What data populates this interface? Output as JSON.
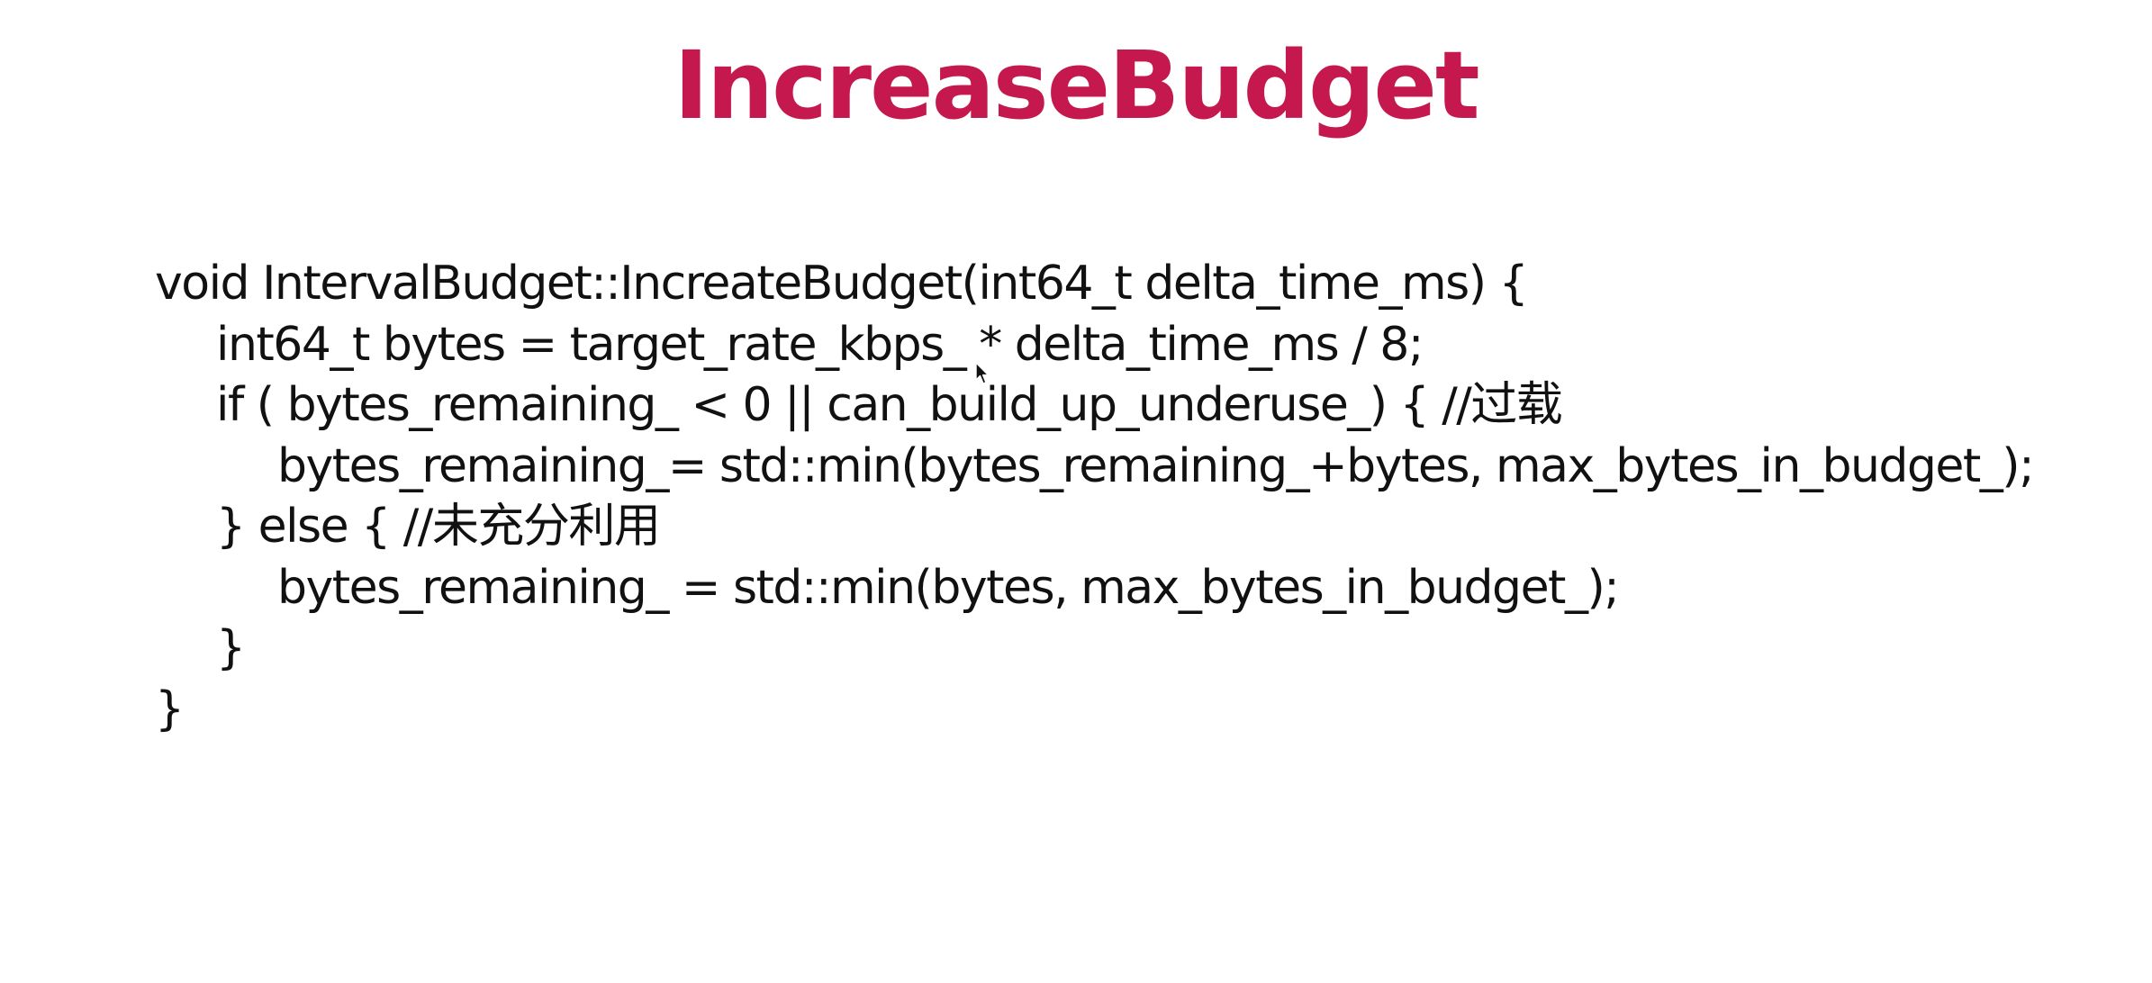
{
  "slide": {
    "title": "IncreaseBudget",
    "title_color": "#c4184e",
    "code_lines": [
      "void IntervalBudget::IncreateBudget(int64_t delta_time_ms) {",
      "int64_t bytes = target_rate_kbps_ * delta_time_ms / 8;",
      "if ( bytes_remaining_ < 0 || can_build_up_underuse_) { //过载",
      "bytes_remaining_= std::min(bytes_remaining_+bytes, max_bytes_in_budget_);",
      "} else { //未充分利用",
      "bytes_remaining_ = std::min(bytes, max_bytes_in_budget_);",
      "}",
      "}"
    ]
  },
  "cursor_icon": "mouse-pointer-icon"
}
